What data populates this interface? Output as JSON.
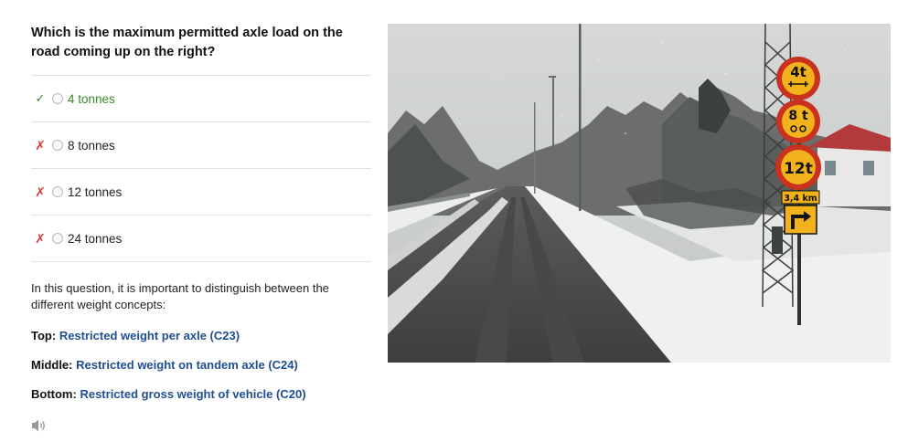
{
  "question": "Which is the maximum permitted axle load on the road coming up on the right?",
  "answers": [
    {
      "label": "4 tonnes",
      "state": "correct"
    },
    {
      "label": "8 tonnes",
      "state": "wrong"
    },
    {
      "label": "12 tonnes",
      "state": "wrong"
    },
    {
      "label": "24 tonnes",
      "state": "wrong"
    }
  ],
  "marks": {
    "correct": "✓",
    "wrong": "✗"
  },
  "explanation": "In this question, it is important to distinguish between the different weight concepts:",
  "definitions": [
    {
      "label": "Top:",
      "link": "Restricted weight per axle (C23)"
    },
    {
      "label": "Middle:",
      "link": "Restricted weight on tandem axle (C24)"
    },
    {
      "label": "Bottom:",
      "link": "Restricted gross weight of vehicle (C20)"
    }
  ],
  "signs": {
    "top": "4t",
    "middle": "8 t",
    "bottom": "12t",
    "distance": "3,4 km"
  },
  "colors": {
    "correct": "#3a8a2a",
    "wrong": "#d43a3a",
    "link": "#1f4f93",
    "sign_yellow": "#f2b21c",
    "sign_red": "#c8321e"
  }
}
